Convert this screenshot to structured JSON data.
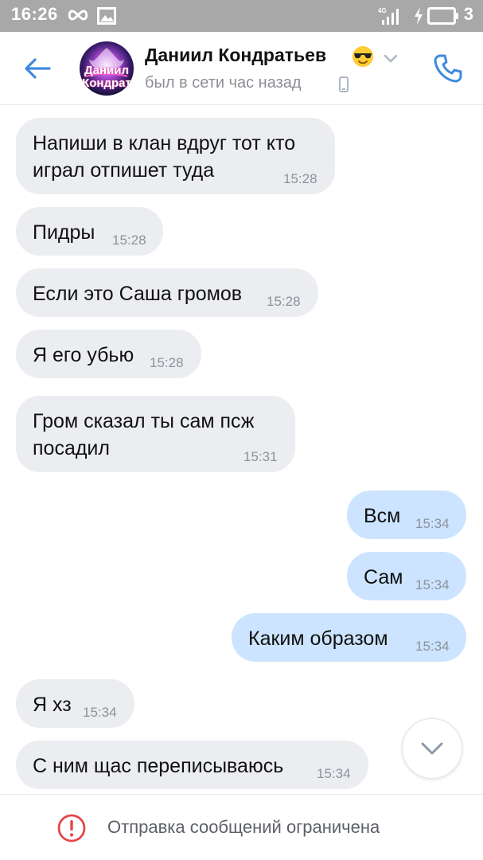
{
  "status_bar": {
    "time": "16:26",
    "battery_level": "3",
    "icons": [
      "infinity-icon",
      "image-icon",
      "signal-4g-icon",
      "charging-icon",
      "battery-icon"
    ]
  },
  "header": {
    "contact_name": "Даниил Кондратьев",
    "status": "был в сети час назад",
    "avatar_text": [
      "Даниил",
      "Кондрат"
    ],
    "icons": [
      "back-arrow-icon",
      "sunglasses-emoji-icon",
      "chevron-down-icon",
      "mobile-phone-icon",
      "phone-call-icon"
    ]
  },
  "messages": [
    {
      "side": "in",
      "lines": [
        "Напиши в клан вдруг тот кто",
        "играл отпишет туда"
      ],
      "time": "15:28"
    },
    {
      "side": "in",
      "lines": [
        "Пидры"
      ],
      "time": "15:28"
    },
    {
      "side": "in",
      "lines": [
        "Если это Саша громов"
      ],
      "time": "15:28"
    },
    {
      "side": "in",
      "lines": [
        "Я его убью"
      ],
      "time": "15:28"
    },
    {
      "side": "in",
      "lines": [
        "Гром сказал ты сам псж",
        "посадил"
      ],
      "time": "15:31"
    },
    {
      "side": "out",
      "lines": [
        "Всм"
      ],
      "time": "15:34"
    },
    {
      "side": "out",
      "lines": [
        "Сам"
      ],
      "time": "15:34"
    },
    {
      "side": "out",
      "lines": [
        "Каким образом"
      ],
      "time": "15:34"
    },
    {
      "side": "in",
      "lines": [
        "Я хз"
      ],
      "time": "15:34"
    },
    {
      "side": "in",
      "lines": [
        "С ним щас переписываюсь"
      ],
      "time": "15:34"
    }
  ],
  "footer": {
    "notice": "Отправка сообщений ограничена"
  },
  "colors": {
    "accent": "#3f8ae0",
    "incoming_bubble": "#ebedf0",
    "outgoing_bubble": "#cce4ff",
    "warning": "#e64646",
    "status_bar": "#a8a8a8"
  }
}
